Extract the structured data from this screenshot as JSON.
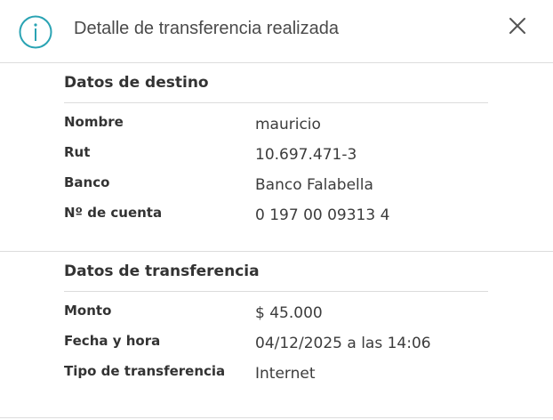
{
  "dialog": {
    "title": "Detalle de transferencia realizada",
    "info_icon": "info-circle-icon",
    "close_icon": "close-icon",
    "accent_color": "#29a3b3"
  },
  "destination": {
    "title": "Datos de destino",
    "rows": [
      {
        "label": "Nombre",
        "value": "mauricio"
      },
      {
        "label": "Rut",
        "value": "10.697.471-3"
      },
      {
        "label": "Banco",
        "value": "Banco Falabella"
      },
      {
        "label": "Nº de cuenta",
        "value": "0 197 00 09313 4"
      }
    ]
  },
  "transfer": {
    "title": "Datos de transferencia",
    "rows": [
      {
        "label": "Monto",
        "value": "$ 45.000"
      },
      {
        "label": "Fecha y hora",
        "value": "04/12/2025 a las 14:06"
      },
      {
        "label": "Tipo de transferencia",
        "value": "Internet"
      }
    ]
  }
}
